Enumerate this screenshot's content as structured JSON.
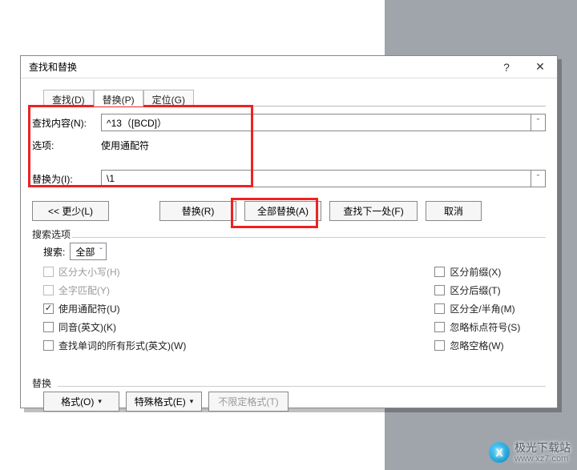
{
  "dialog": {
    "title": "查找和替换",
    "help_symbol": "?",
    "close_symbol": "✕"
  },
  "tabs": {
    "find": "查找(D)",
    "replace": "替换(P)",
    "goto": "定位(G)"
  },
  "fields": {
    "find_label": "查找内容(N):",
    "find_value": "^13（[BCD]）",
    "options_label": "选项:",
    "options_value": "使用通配符",
    "replace_label": "替换为(I):",
    "replace_value": "\\1"
  },
  "buttons": {
    "less": "<< 更少(L)",
    "replace": "替换(R)",
    "replace_all": "全部替换(A)",
    "find_next": "查找下一处(F)",
    "cancel": "取消"
  },
  "search_options": {
    "header": "搜索选项",
    "search_label": "搜索:",
    "search_value": "全部",
    "match_case": "区分大小写(H)",
    "whole_word": "全字匹配(Y)",
    "use_wildcards": "使用通配符(U)",
    "sounds_like": "同音(英文)(K)",
    "all_forms": "查找单词的所有形式(英文)(W)",
    "match_prefix": "区分前缀(X)",
    "match_suffix": "区分后缀(T)",
    "match_width": "区分全/半角(M)",
    "ignore_punct": "忽略标点符号(S)",
    "ignore_space": "忽略空格(W)"
  },
  "replace_group": {
    "header": "替换",
    "format": "格式(O)",
    "special": "特殊格式(E)",
    "no_format": "不限定格式(T)"
  },
  "watermark": {
    "text1": "极光下载站",
    "text2": "www.xz7.com"
  },
  "dropdown_glyph": "ˇ",
  "tri_down": "▾",
  "checkmark": "✓"
}
